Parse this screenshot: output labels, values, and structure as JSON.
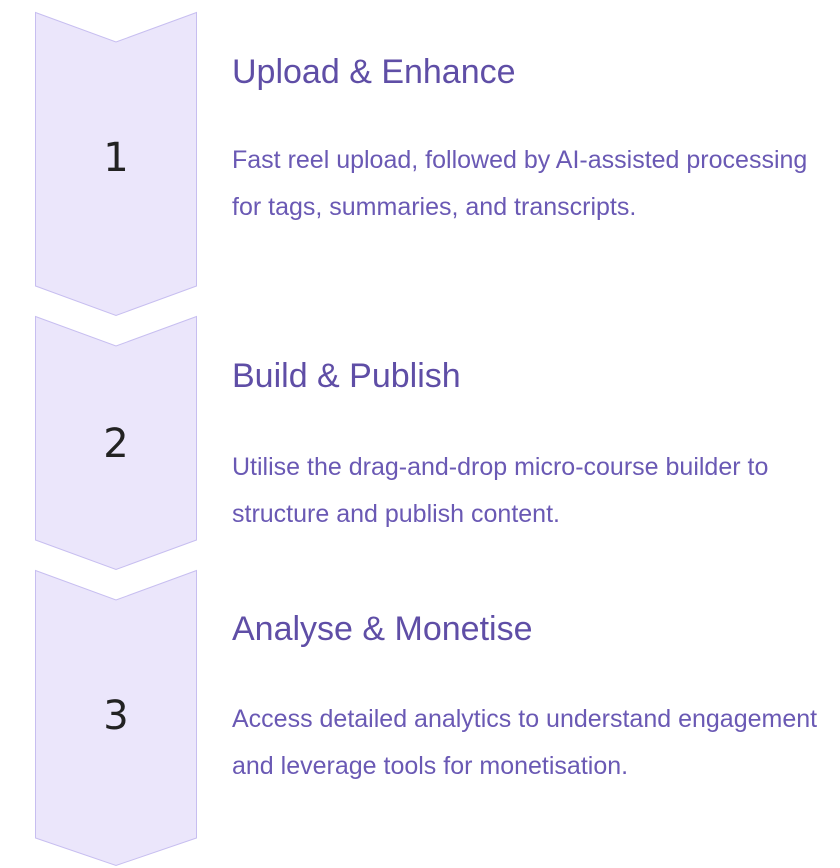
{
  "steps": [
    {
      "number": "1",
      "title": "Upload & Enhance",
      "description": "Fast reel upload, followed by AI-assisted processing for tags, summaries, and transcripts."
    },
    {
      "number": "2",
      "title": "Build & Publish",
      "description": "Utilise the drag-and-drop micro-course builder to structure and publish content."
    },
    {
      "number": "3",
      "title": "Analyse & Monetise",
      "description": "Access detailed analytics to understand engagement and leverage tools for monetisation."
    }
  ],
  "colors": {
    "chevron_fill": "#ebe6fb",
    "chevron_stroke": "#c7bef0",
    "title": "#5f4ea6",
    "description": "#6a59b4",
    "number": "#222222"
  }
}
